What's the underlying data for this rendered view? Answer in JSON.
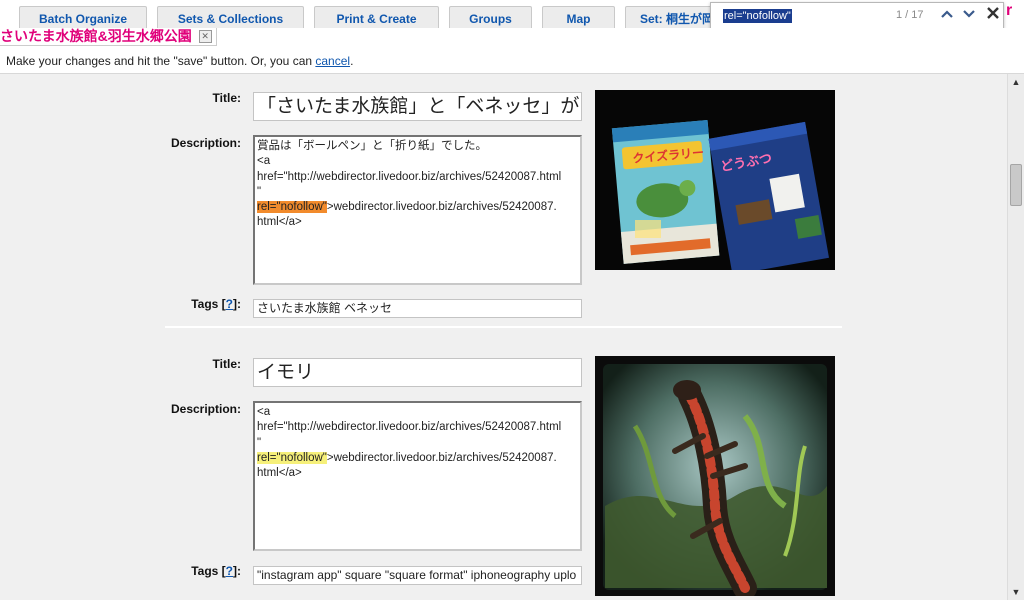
{
  "nav": {
    "tabs": [
      {
        "label": "Batch Organize"
      },
      {
        "label": "Sets & Collections"
      },
      {
        "label": "Print & Create"
      },
      {
        "label": "Groups"
      },
      {
        "label": "Map"
      },
      {
        "label": "Set: 桐生が岡"
      }
    ]
  },
  "find": {
    "query": "rel=\"nofollow\"",
    "count": "1 / 17"
  },
  "album": {
    "title": "さいたま水族館&羽生水郷公園"
  },
  "info": {
    "message": "Make your changes and hit the \"save\" button. Or, you can ",
    "cancel_link": "cancel",
    "end": "."
  },
  "labels": {
    "title": "Title:",
    "description": "Description:",
    "tags": "Tags [",
    "help": "?",
    "tags_end": "]:"
  },
  "photos": [
    {
      "title": "「さいたま水族館」と「ベネッセ」がコラ",
      "description": {
        "line1": "賞品は「ボールペン」と「折り紙」でした。",
        "line2": "<a",
        "line3": "href=\"http://webdirector.livedoor.biz/archives/52420087.html",
        "line4": "\"",
        "highlight": "rel=\"nofollow\"",
        "after": ">webdirector.livedoor.biz/archives/52420087.",
        "line6": "html</a>"
      },
      "tags": "さいたま水族館 ベネッセ",
      "image_caption_1": "クイズラリー",
      "image_caption_2": "どうぶつ"
    },
    {
      "title": "イモリ",
      "description": {
        "line1": "<a",
        "line2": "href=\"http://webdirector.livedoor.biz/archives/52420087.html",
        "line3": "\"",
        "highlight": "rel=\"nofollow\"",
        "after": ">webdirector.livedoor.biz/archives/52420087.",
        "line5": "html</a>"
      },
      "tags": "\"instagram app\" square \"square format\" iphoneography uplo"
    }
  ],
  "colors": {
    "tab_text": "#1057ae",
    "album_title": "#e0007a",
    "highlight_current": "#f28b2c",
    "highlight_other": "#f6f07a"
  }
}
